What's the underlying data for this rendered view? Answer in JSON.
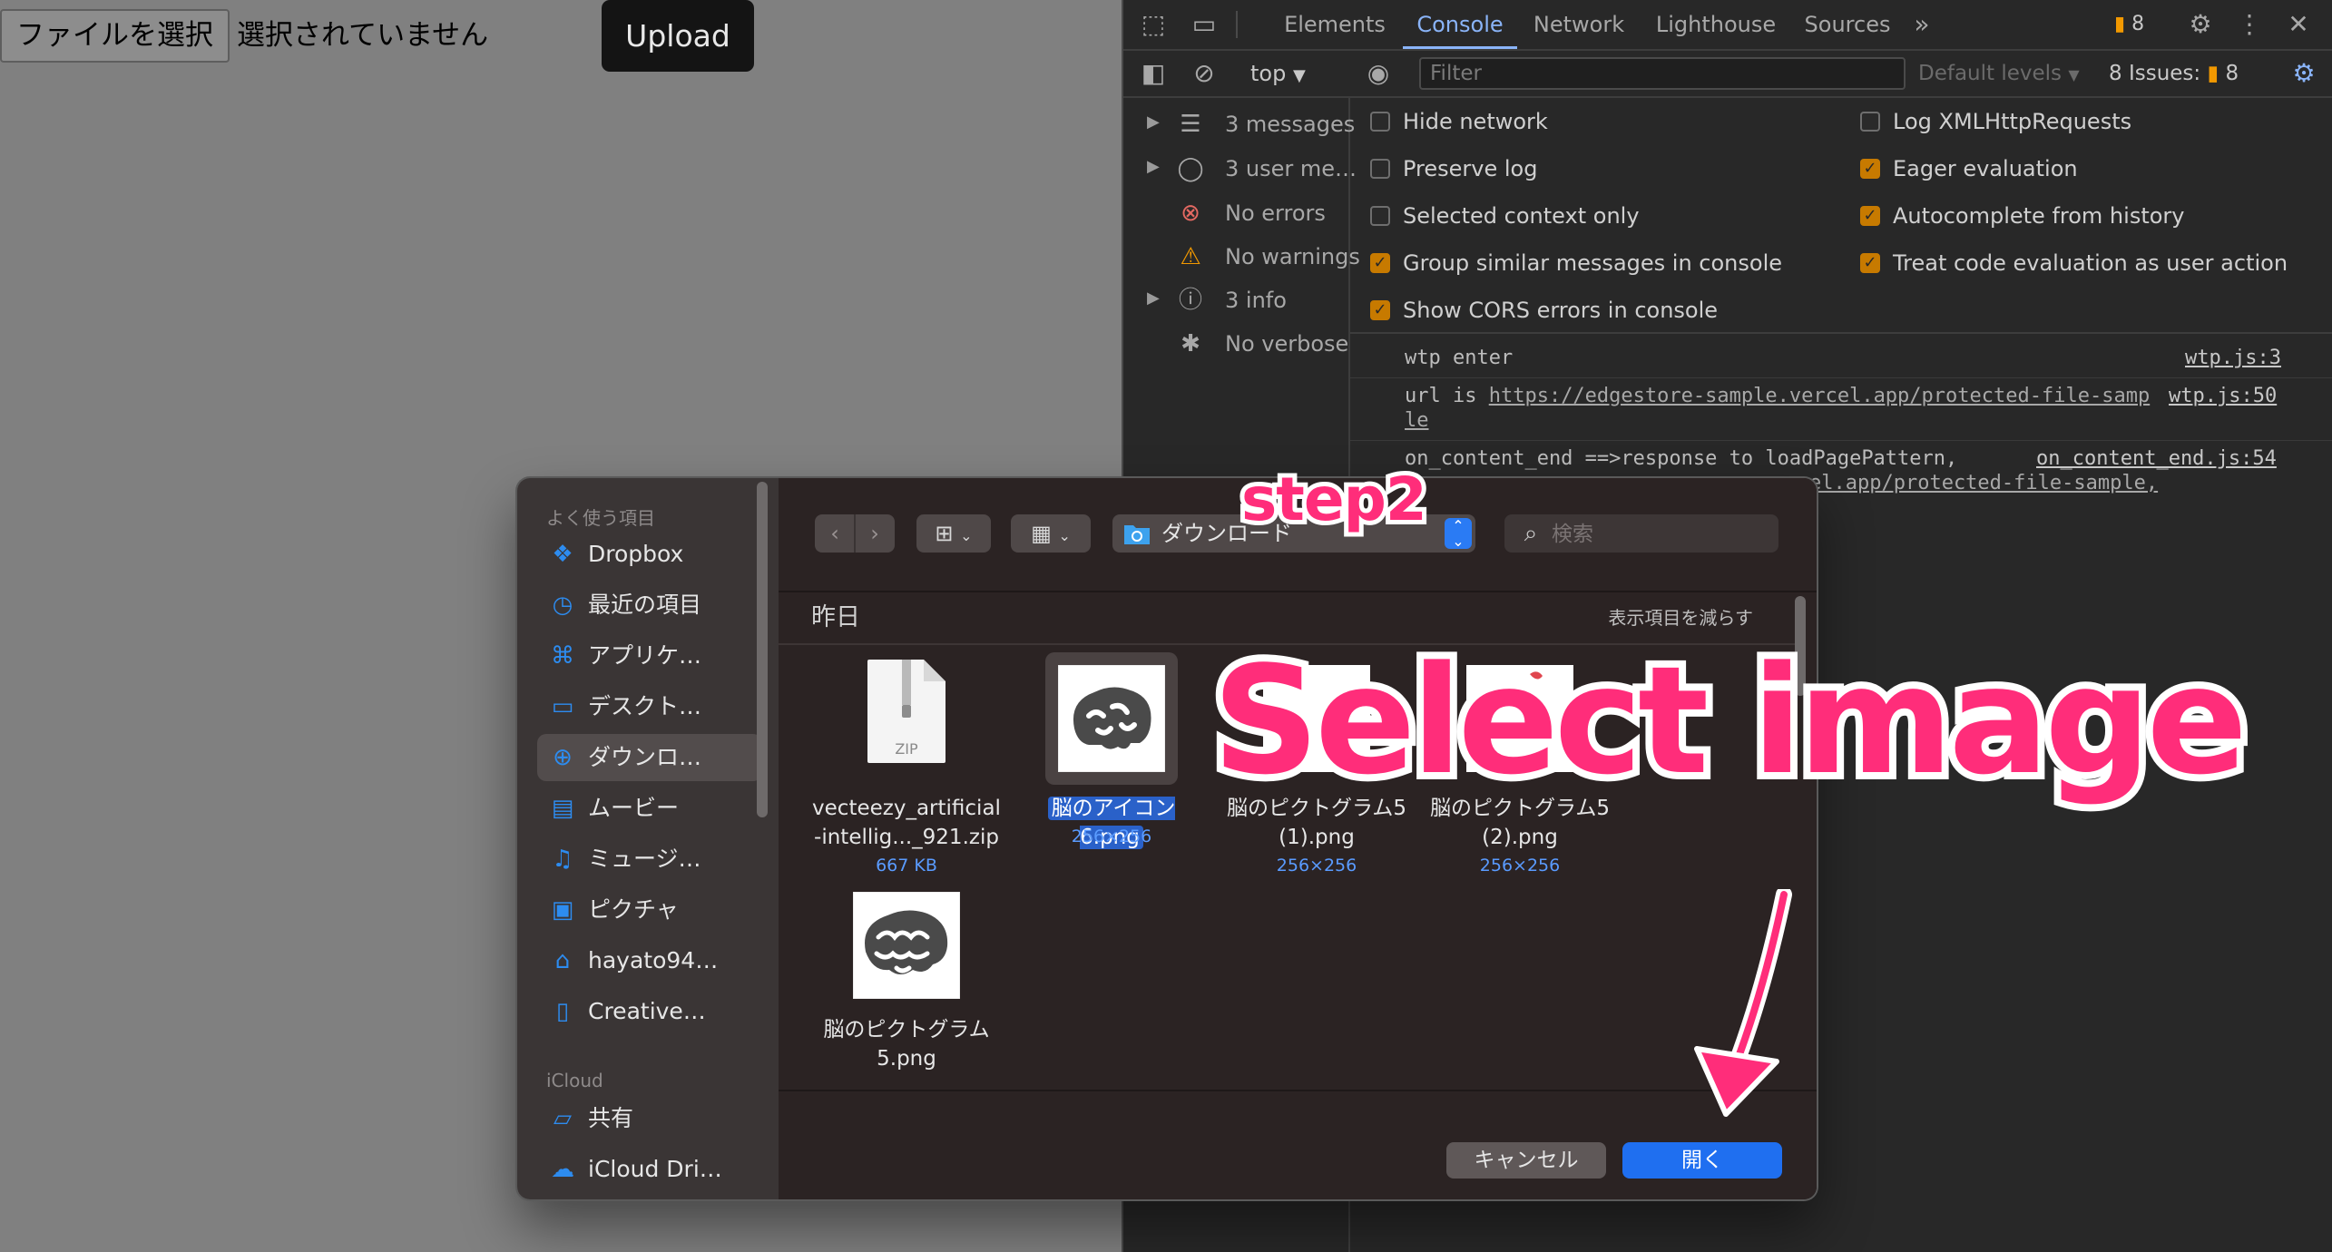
{
  "page": {
    "file_button_label": "ファイルを選択",
    "no_file_text": "選択されていません",
    "upload_label": "Upload"
  },
  "devtools": {
    "tabs": [
      "Elements",
      "Console",
      "Network",
      "Lighthouse",
      "Sources"
    ],
    "active_tab": "Console",
    "more_tabs_icon": "»",
    "issue_badge_count": "8",
    "context": "top",
    "filter_placeholder": "Filter",
    "default_levels": "Default levels",
    "issues_label": "8 Issues:",
    "issues_count": "8",
    "sidebar": [
      {
        "icon": "list-icon",
        "label": "3 messages",
        "expandable": true
      },
      {
        "icon": "user-icon",
        "label": "3 user me…",
        "expandable": true
      },
      {
        "icon": "error-icon",
        "label": "No errors",
        "expandable": false
      },
      {
        "icon": "warning-icon",
        "label": "No warnings",
        "expandable": false
      },
      {
        "icon": "info-icon",
        "label": "3 info",
        "expandable": true
      },
      {
        "icon": "bug-icon",
        "label": "No verbose",
        "expandable": false
      }
    ],
    "settings_left": [
      {
        "label": "Hide network",
        "checked": false
      },
      {
        "label": "Preserve log",
        "checked": false
      },
      {
        "label": "Selected context only",
        "checked": false
      },
      {
        "label": "Group similar messages in console",
        "checked": true
      },
      {
        "label": "Show CORS errors in console",
        "checked": true
      }
    ],
    "settings_right": [
      {
        "label": "Log XMLHttpRequests",
        "checked": false
      },
      {
        "label": "Eager evaluation",
        "checked": true
      },
      {
        "label": "Autocomplete from history",
        "checked": true
      },
      {
        "label": "Treat code evaluation as user action",
        "checked": true
      }
    ],
    "logs": [
      {
        "text": "wtp enter",
        "source": "wtp.js:3"
      },
      {
        "text": "url is ",
        "link": "https://edgestore-sample.vercel.app/protected-file-samp",
        "link_cont": "le",
        "source": "wtp.js:50"
      },
      {
        "text": "on_content_end ==>response to loadPagePattern,",
        "source": "on_content_end.js:54",
        "cont": "el.app/protected-file-sample,"
      }
    ]
  },
  "dialog": {
    "favorites_title": "よく使う項目",
    "favorites": [
      {
        "icon": "dropbox-icon",
        "label": "Dropbox",
        "selected": false
      },
      {
        "icon": "clock-icon",
        "label": "最近の項目",
        "selected": false
      },
      {
        "icon": "applications-icon",
        "label": "アプリケ…",
        "selected": false
      },
      {
        "icon": "desktop-icon",
        "label": "デスクト…",
        "selected": false
      },
      {
        "icon": "downloads-icon",
        "label": "ダウンロ…",
        "selected": true
      },
      {
        "icon": "movies-icon",
        "label": "ムービー",
        "selected": false
      },
      {
        "icon": "music-icon",
        "label": "ミュージ…",
        "selected": false
      },
      {
        "icon": "pictures-icon",
        "label": "ピクチャ",
        "selected": false
      },
      {
        "icon": "home-icon",
        "label": "hayato94…",
        "selected": false
      },
      {
        "icon": "document-icon",
        "label": "Creative…",
        "selected": false
      }
    ],
    "icloud_title": "iCloud",
    "icloud": [
      {
        "icon": "shared-folder-icon",
        "label": "共有"
      },
      {
        "icon": "cloud-icon",
        "label": "iCloud Dri…"
      }
    ],
    "location": "ダウンロード",
    "search_placeholder": "検索",
    "group_title": "昨日",
    "group_action": "表示項目を減らす",
    "files": [
      {
        "name_l1": "vecteezy_artificial",
        "name_l2": "-intellig..._921.zip",
        "meta": "667 KB",
        "kind": "zip",
        "badge": "ZIP"
      },
      {
        "name_l1": "脳のアイコン6.png",
        "name_l2": "",
        "meta": "256×256",
        "kind": "image-selected"
      },
      {
        "name_l1": "脳のピクトグラム5",
        "name_l2": "(1).png",
        "meta": "256×256",
        "kind": "image"
      },
      {
        "name_l1": "脳のピクトグラム5",
        "name_l2": "(2).png",
        "meta": "256×256",
        "kind": "image"
      },
      {
        "name_l1": "脳のピクトグラム",
        "name_l2": "5.png",
        "meta": "",
        "kind": "image"
      }
    ],
    "cancel_label": "キャンセル",
    "open_label": "開く"
  },
  "annotations": {
    "step": "step2",
    "caption": "Select image",
    "accent_color": "#ff2d7a"
  }
}
